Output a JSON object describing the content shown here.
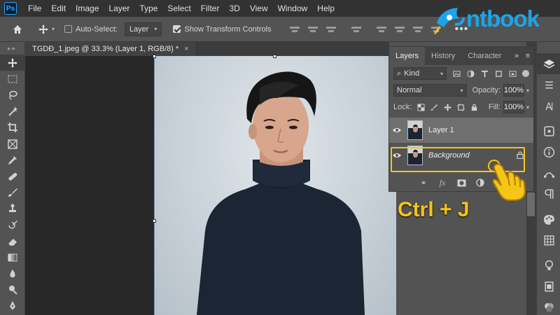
{
  "menubar": {
    "logo": "Ps",
    "items": [
      "File",
      "Edit",
      "Image",
      "Layer",
      "Type",
      "Select",
      "Filter",
      "3D",
      "View",
      "Window",
      "Help"
    ]
  },
  "options": {
    "auto_select_label": "Auto-Select:",
    "auto_select_target": "Layer",
    "show_transform_label": "Show Transform Controls",
    "more": "•••"
  },
  "document": {
    "tab_title": "TGDĐ_1.jpeg @ 33.3% (Layer 1, RGB/8) *",
    "tab_close": "×"
  },
  "layers_panel": {
    "tabs": [
      "Layers",
      "History",
      "Character"
    ],
    "filter_kind": "Kind",
    "blend_mode": "Normal",
    "opacity_label": "Opacity:",
    "opacity_value": "100%",
    "lock_label": "Lock:",
    "fill_label": "Fill:",
    "fill_value": "100%",
    "layers": [
      {
        "name": "Layer 1",
        "selected": true,
        "locked": false
      },
      {
        "name": "Background",
        "selected": false,
        "locked": true
      }
    ],
    "footer": [
      "link",
      "fx",
      "mask",
      "adjustment",
      "group"
    ]
  },
  "overlay": {
    "brand_logo": "ntbook",
    "shortcut": "Ctrl + J",
    "highlight_color": "#f5c518",
    "brand_color": "#1da4e8"
  }
}
